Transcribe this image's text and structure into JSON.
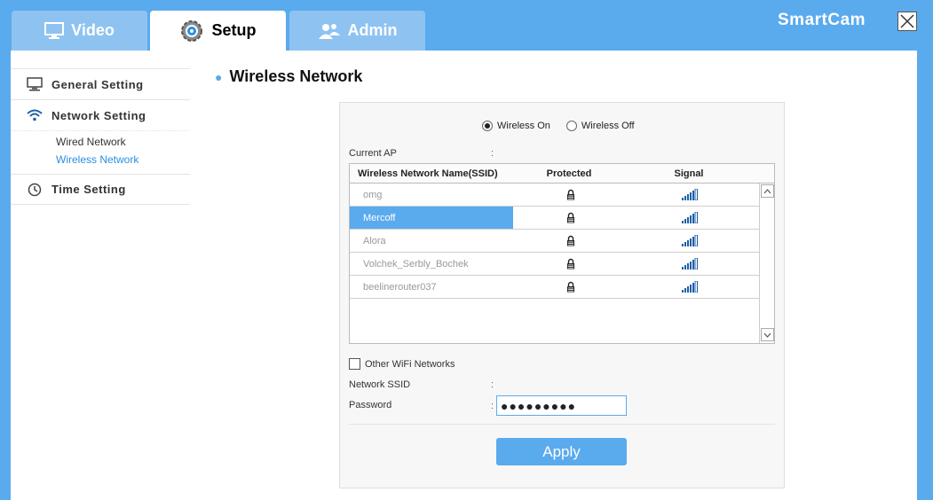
{
  "tabs": [
    {
      "label": "Video",
      "icon": "monitor-icon",
      "active": false
    },
    {
      "label": "Setup",
      "icon": "gear-icon",
      "active": true
    },
    {
      "label": "Admin",
      "icon": "users-icon",
      "active": false
    }
  ],
  "brand": "SmartCam",
  "sidebar": {
    "items": [
      {
        "label": "General Setting",
        "icon": "monitor-icon"
      },
      {
        "label": "Network Setting",
        "icon": "wifi-icon"
      },
      {
        "label": "Time Setting",
        "icon": "clock-icon"
      }
    ],
    "network_sub": [
      "Wired Network",
      "Wireless Network"
    ]
  },
  "page": {
    "title": "Wireless Network"
  },
  "wireless": {
    "on_label": "Wireless On",
    "off_label": "Wireless Off",
    "selected": "on",
    "current_ap_label": "Current AP",
    "colon": ":",
    "table": {
      "headers": [
        "Wireless Network Name(SSID)",
        "Protected",
        "Signal"
      ],
      "rows": [
        {
          "ssid": "omg",
          "protected": true,
          "selected": false
        },
        {
          "ssid": "Mercoff",
          "protected": true,
          "selected": true
        },
        {
          "ssid": "Alora",
          "protected": true,
          "selected": false
        },
        {
          "ssid": "Volchek_Serbly_Bochek",
          "protected": true,
          "selected": false
        },
        {
          "ssid": "beelinerouter037",
          "protected": true,
          "selected": false
        }
      ]
    },
    "other_wifi_label": "Other WiFi Networks",
    "network_ssid_label": "Network SSID",
    "password_label": "Password",
    "password_value": "●●●●●●●●●",
    "apply_label": "Apply"
  },
  "colors": {
    "accent": "#5aaaee",
    "selected_row": "#5aaaee"
  }
}
